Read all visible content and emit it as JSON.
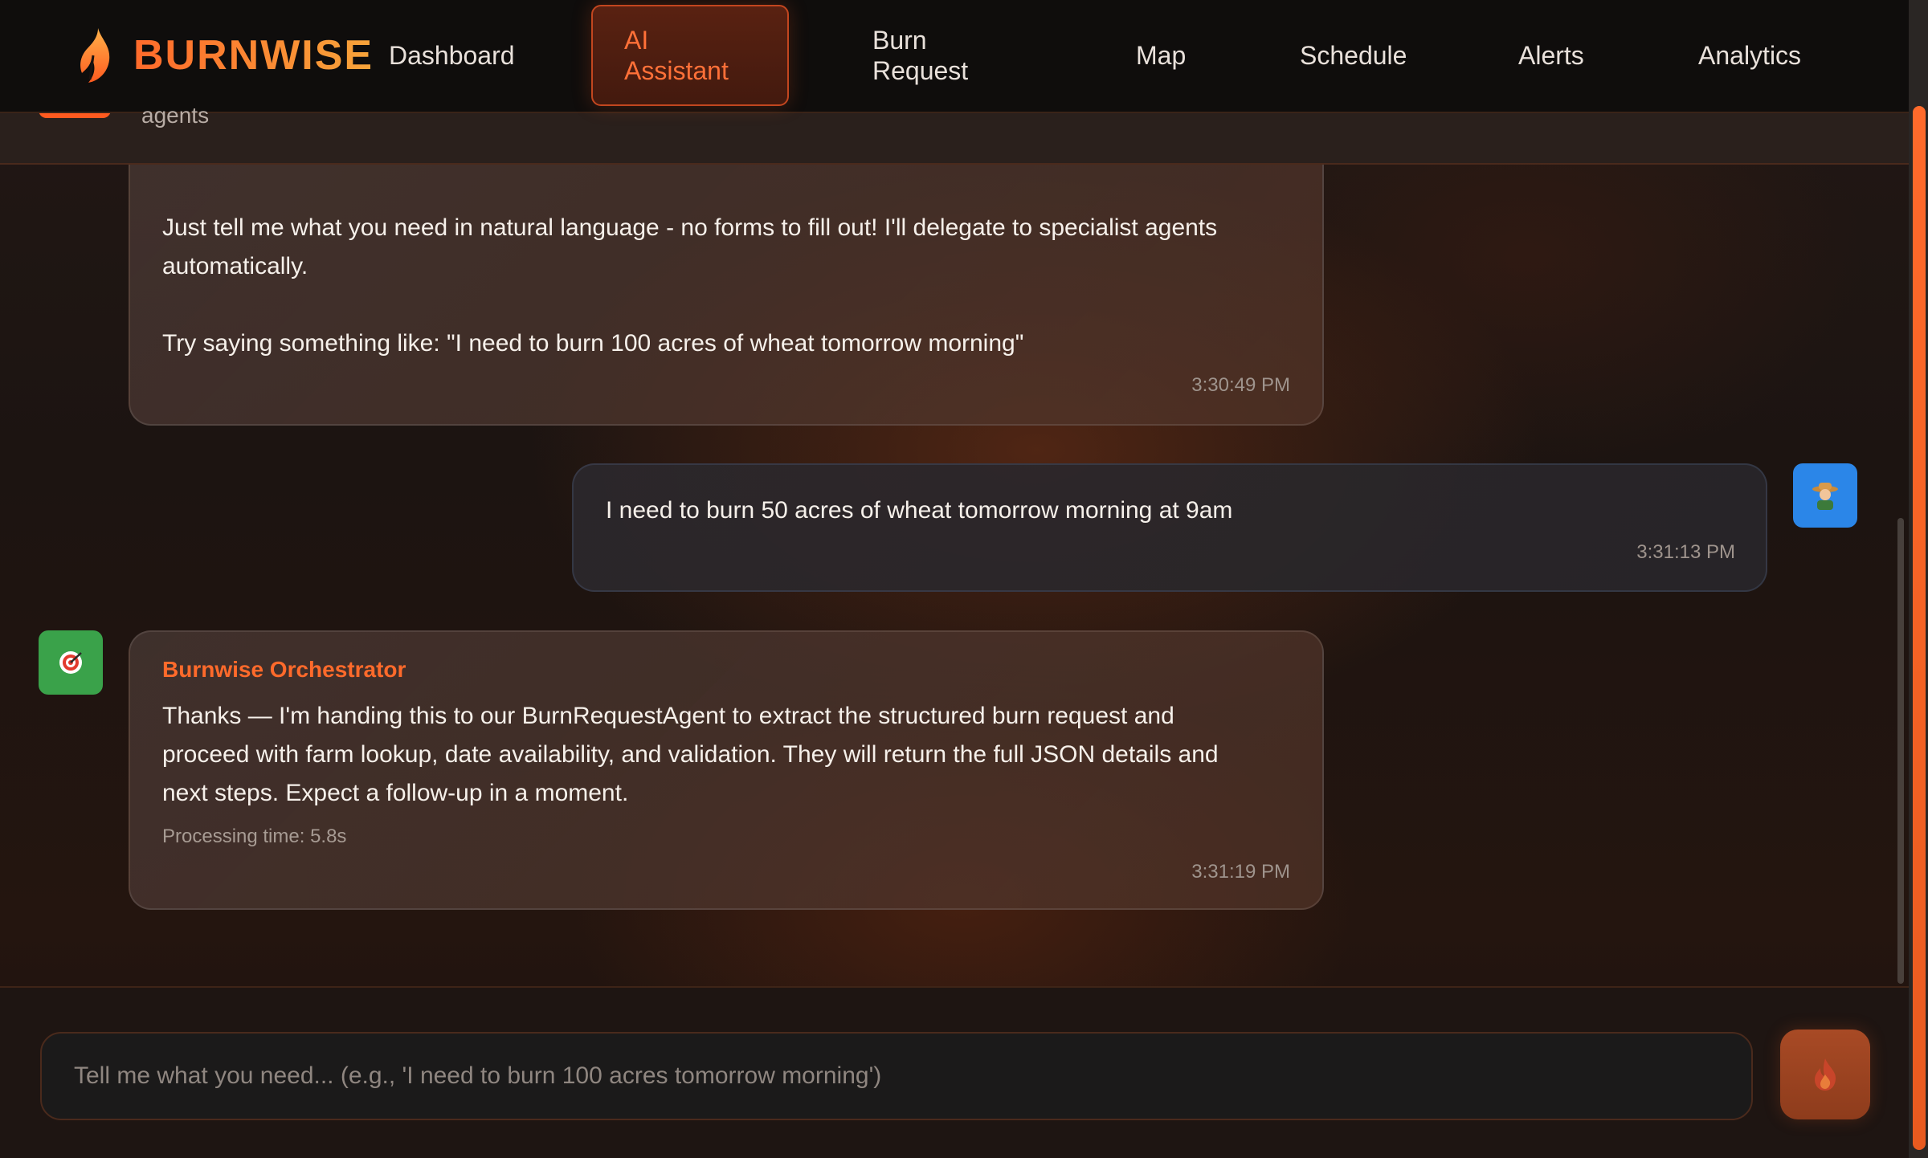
{
  "brand": {
    "name": "BURNWISE",
    "logo_icon": "flame-icon"
  },
  "nav": {
    "items": [
      {
        "label": "Dashboard",
        "active": false
      },
      {
        "label": "AI\nAssistant",
        "active": true
      },
      {
        "label": "Burn\nRequest",
        "active": false
      },
      {
        "label": "Map",
        "active": false
      },
      {
        "label": "Schedule",
        "active": false
      },
      {
        "label": "Alerts",
        "active": false
      },
      {
        "label": "Analytics",
        "active": false
      }
    ]
  },
  "subheader": {
    "text": "agents"
  },
  "messages": [
    {
      "role": "agent",
      "text_lines": [
        "Just tell me what you need in natural language - no forms to fill out! I'll delegate to specialist agents",
        "automatically.",
        "",
        "Try saying something like: \"I need to burn 100 acres of wheat tomorrow morning\""
      ],
      "time": "3:30:49 PM"
    },
    {
      "role": "user",
      "text": "I need to burn 50 acres of wheat tomorrow morning at 9am",
      "time": "3:31:13 PM",
      "avatar_icon": "farmer-icon"
    },
    {
      "role": "agent",
      "sender": "Burnwise Orchestrator",
      "text_lines": [
        "Thanks — I'm handing this to our BurnRequestAgent to extract the structured burn request and",
        "proceed with farm lookup, date availability, and validation. They will return the full JSON details and",
        "next steps. Expect a follow-up in a moment."
      ],
      "meta": "Processing time: 5.8s",
      "time": "3:31:19 PM",
      "avatar_icon": "target-icon"
    }
  ],
  "composer": {
    "placeholder": "Tell me what you need... (e.g., 'I need to burn 100 acres tomorrow morning')",
    "value": "",
    "send_icon": "flame-icon"
  },
  "colors": {
    "accent": "#ff6a2b",
    "user_avatar": "#2b86e8",
    "agent_avatar": "#3aa24a"
  }
}
